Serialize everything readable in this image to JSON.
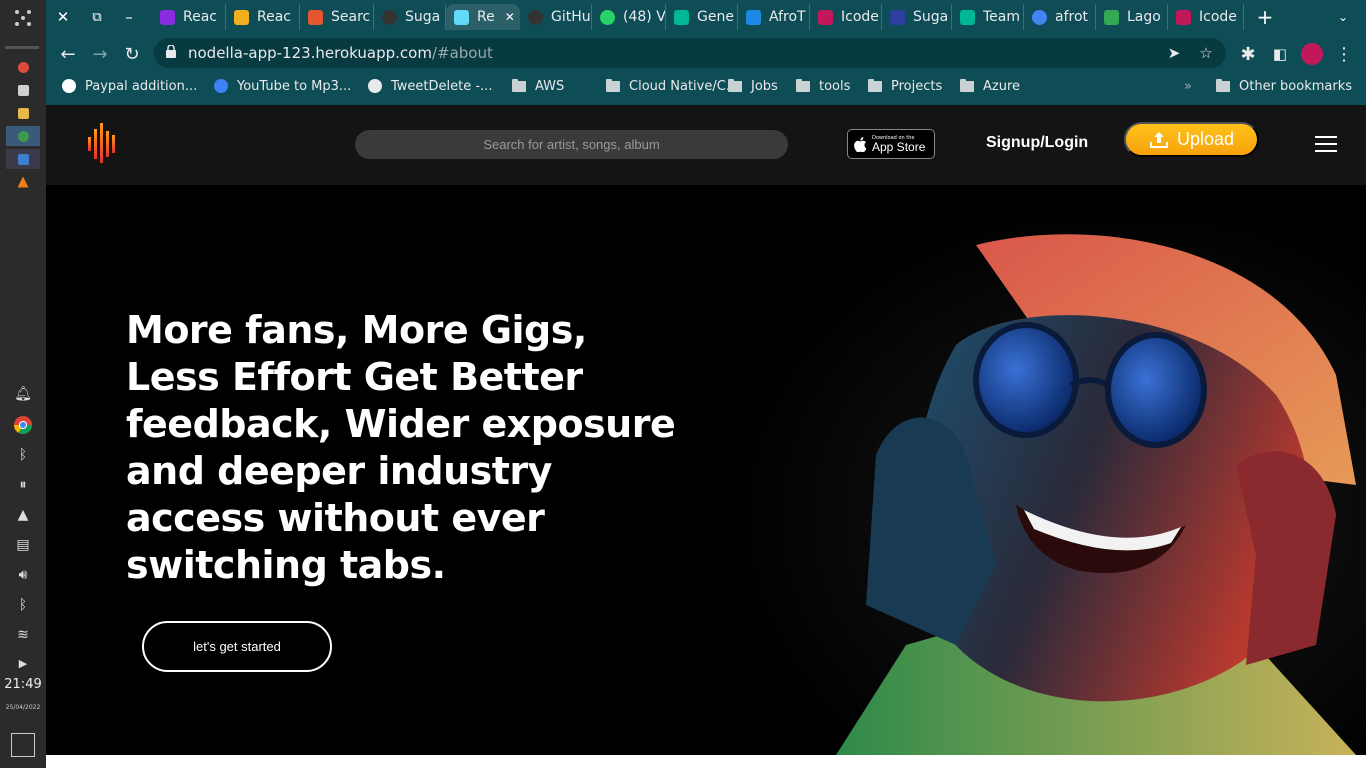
{
  "taskbar": {
    "apps": [
      {
        "name": "start-menu-icon",
        "color": "#cfcfcf"
      },
      {
        "name": "app-indicator-icon",
        "color": "#e04a3a"
      },
      {
        "name": "files-icon",
        "color": "#d0d0d0"
      },
      {
        "name": "notes-icon",
        "color": "#e8b84a"
      },
      {
        "name": "chrome-icon",
        "color": "#3c9a4a"
      },
      {
        "name": "vscode-icon",
        "color": "#3b7fd1"
      },
      {
        "name": "vlc-icon",
        "color": "#f07f1a"
      }
    ],
    "tray": [
      "bell-icon",
      "chrome-icon",
      "bluetooth-icon",
      "pause-icon",
      "vlc-icon",
      "clipboard-icon",
      "volume-icon",
      "bluetooth-icon",
      "wifi-icon",
      "expand-icon"
    ],
    "time": "21:49",
    "date": "25/04/2022"
  },
  "browser": {
    "tabs": [
      {
        "label": "Reac",
        "icon": "react-icon",
        "color": "#8a2be2"
      },
      {
        "label": "Reac",
        "icon": "headphones-icon",
        "color": "#f2b01e"
      },
      {
        "label": "Searc",
        "icon": "microsoft-icon",
        "color": "#e4572e"
      },
      {
        "label": "Suga",
        "icon": "github-icon",
        "color": "#333333"
      },
      {
        "label": "Re",
        "icon": "react-icon",
        "color": "#61dafb",
        "active": true
      },
      {
        "label": "GitHu",
        "icon": "github-icon",
        "color": "#333333"
      },
      {
        "label": "(48) V",
        "icon": "whatsapp-icon",
        "color": "#25d366"
      },
      {
        "label": "Gene",
        "icon": "diamond-icon",
        "color": "#00b894"
      },
      {
        "label": "AfroT",
        "icon": "plane-icon",
        "color": "#1e88e5"
      },
      {
        "label": "Icode",
        "icon": "icodeguru-icon",
        "color": "#c2185b"
      },
      {
        "label": "Suga",
        "icon": "ibm-icon",
        "color": "#2c3e9e"
      },
      {
        "label": "Team",
        "icon": "diamond-icon",
        "color": "#00b894"
      },
      {
        "label": "afrot",
        "icon": "google-icon",
        "color": "#4285f4"
      },
      {
        "label": "Lago",
        "icon": "maps-icon",
        "color": "#34a853"
      },
      {
        "label": "Icode",
        "icon": "icodeguru-icon",
        "color": "#c2185b"
      }
    ],
    "url_host": "nodella-app-123.herokuapp.com",
    "url_path": "/#about",
    "bookmarks": [
      {
        "label": "Paypal addition...",
        "icon": "paypal-icon"
      },
      {
        "label": "YouTube to Mp3...",
        "icon": "info-icon"
      },
      {
        "label": "TweetDelete -...",
        "icon": "trash-icon"
      },
      {
        "label": "AWS",
        "icon": "folder-icon"
      },
      {
        "label": "Cloud Native/C...",
        "icon": "folder-icon"
      },
      {
        "label": "Jobs",
        "icon": "folder-icon"
      },
      {
        "label": "tools",
        "icon": "folder-icon"
      },
      {
        "label": "Projects",
        "icon": "folder-icon"
      },
      {
        "label": "Azure",
        "icon": "folder-icon"
      }
    ],
    "more_bookmarks": "»",
    "other_bookmarks": "Other bookmarks"
  },
  "site": {
    "search_placeholder": "Search for artist, songs, album",
    "appstore_small": "Download on the",
    "appstore_big": "App Store",
    "signup_label": "Signup/Login",
    "upload_label": "Upload",
    "hero_title": "More fans, More Gigs, Less Effort Get Better feedback, Wider exposure and deeper industry access without ever switching tabs.",
    "cta_label": "let's get started",
    "accent_color": "#f7a20d"
  }
}
